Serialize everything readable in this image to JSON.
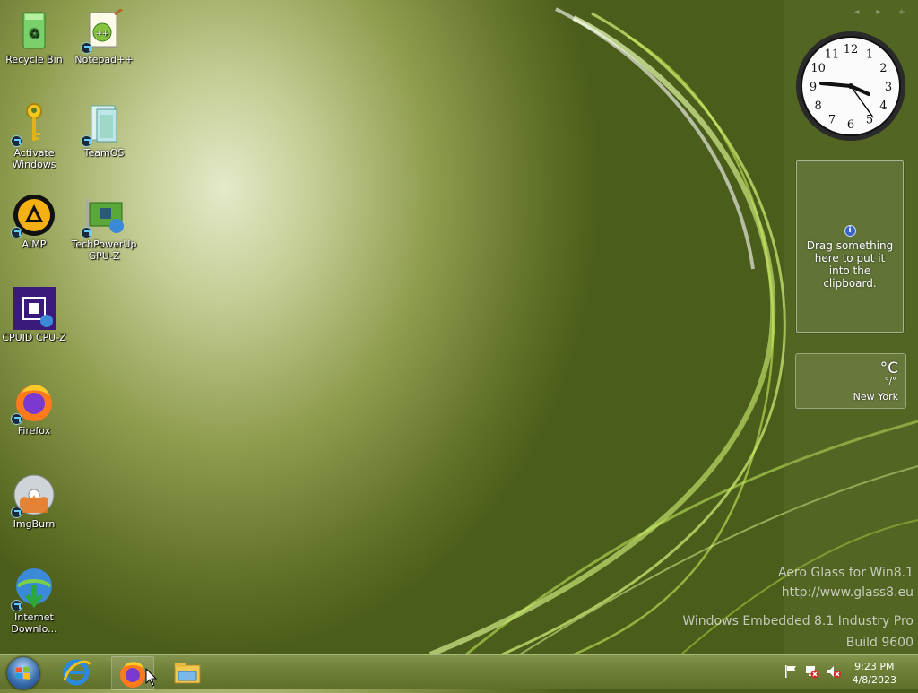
{
  "desktop_icons": [
    {
      "label": "Recycle Bin",
      "icon": "recycle-bin-icon"
    },
    {
      "label": "Notepad++",
      "icon": "notepad-plus-plus-icon"
    },
    {
      "label": "Activate Windows",
      "icon": "key-icon"
    },
    {
      "label": "TeamOS",
      "icon": "teamos-icon"
    },
    {
      "label": "AIMP",
      "icon": "aimp-icon"
    },
    {
      "label": "TechPowerUp GPU-Z",
      "icon": "gpu-z-icon"
    },
    {
      "label": "CPUID CPU-Z",
      "icon": "cpu-z-icon"
    },
    {
      "label": "Firefox",
      "icon": "firefox-icon"
    },
    {
      "label": "ImgBurn",
      "icon": "imgburn-icon"
    },
    {
      "label": "Internet Downlo...",
      "icon": "internet-download-manager-icon"
    }
  ],
  "gadgets": {
    "clock": {
      "hour_numbers": [
        "12",
        "1",
        "2",
        "3",
        "4",
        "5",
        "6",
        "7",
        "8",
        "9",
        "10",
        "11"
      ]
    },
    "clipboard": {
      "message": "Drag something here to put it into the clipboard."
    },
    "weather": {
      "temperature": "°C",
      "range": "°/°",
      "city": "New York"
    }
  },
  "watermark": {
    "line1": "Aero Glass for Win8.1",
    "line2": "http://www.glass8.eu",
    "line3": "Windows Embedded 8.1 Industry Pro",
    "line4": "Build 9600"
  },
  "taskbar": {
    "pinned": [
      "internet-explorer-icon",
      "firefox-icon",
      "file-explorer-icon"
    ],
    "time": "9:23 PM",
    "date": "4/8/2023",
    "tray_icons": [
      "action-center-flag-icon",
      "network-disconnected-icon",
      "volume-muted-icon"
    ]
  },
  "colors": {
    "accent": "#6f8038",
    "wallpaper_highlight": "#e4e9c9",
    "wallpaper_dark": "#4b5d1a"
  }
}
